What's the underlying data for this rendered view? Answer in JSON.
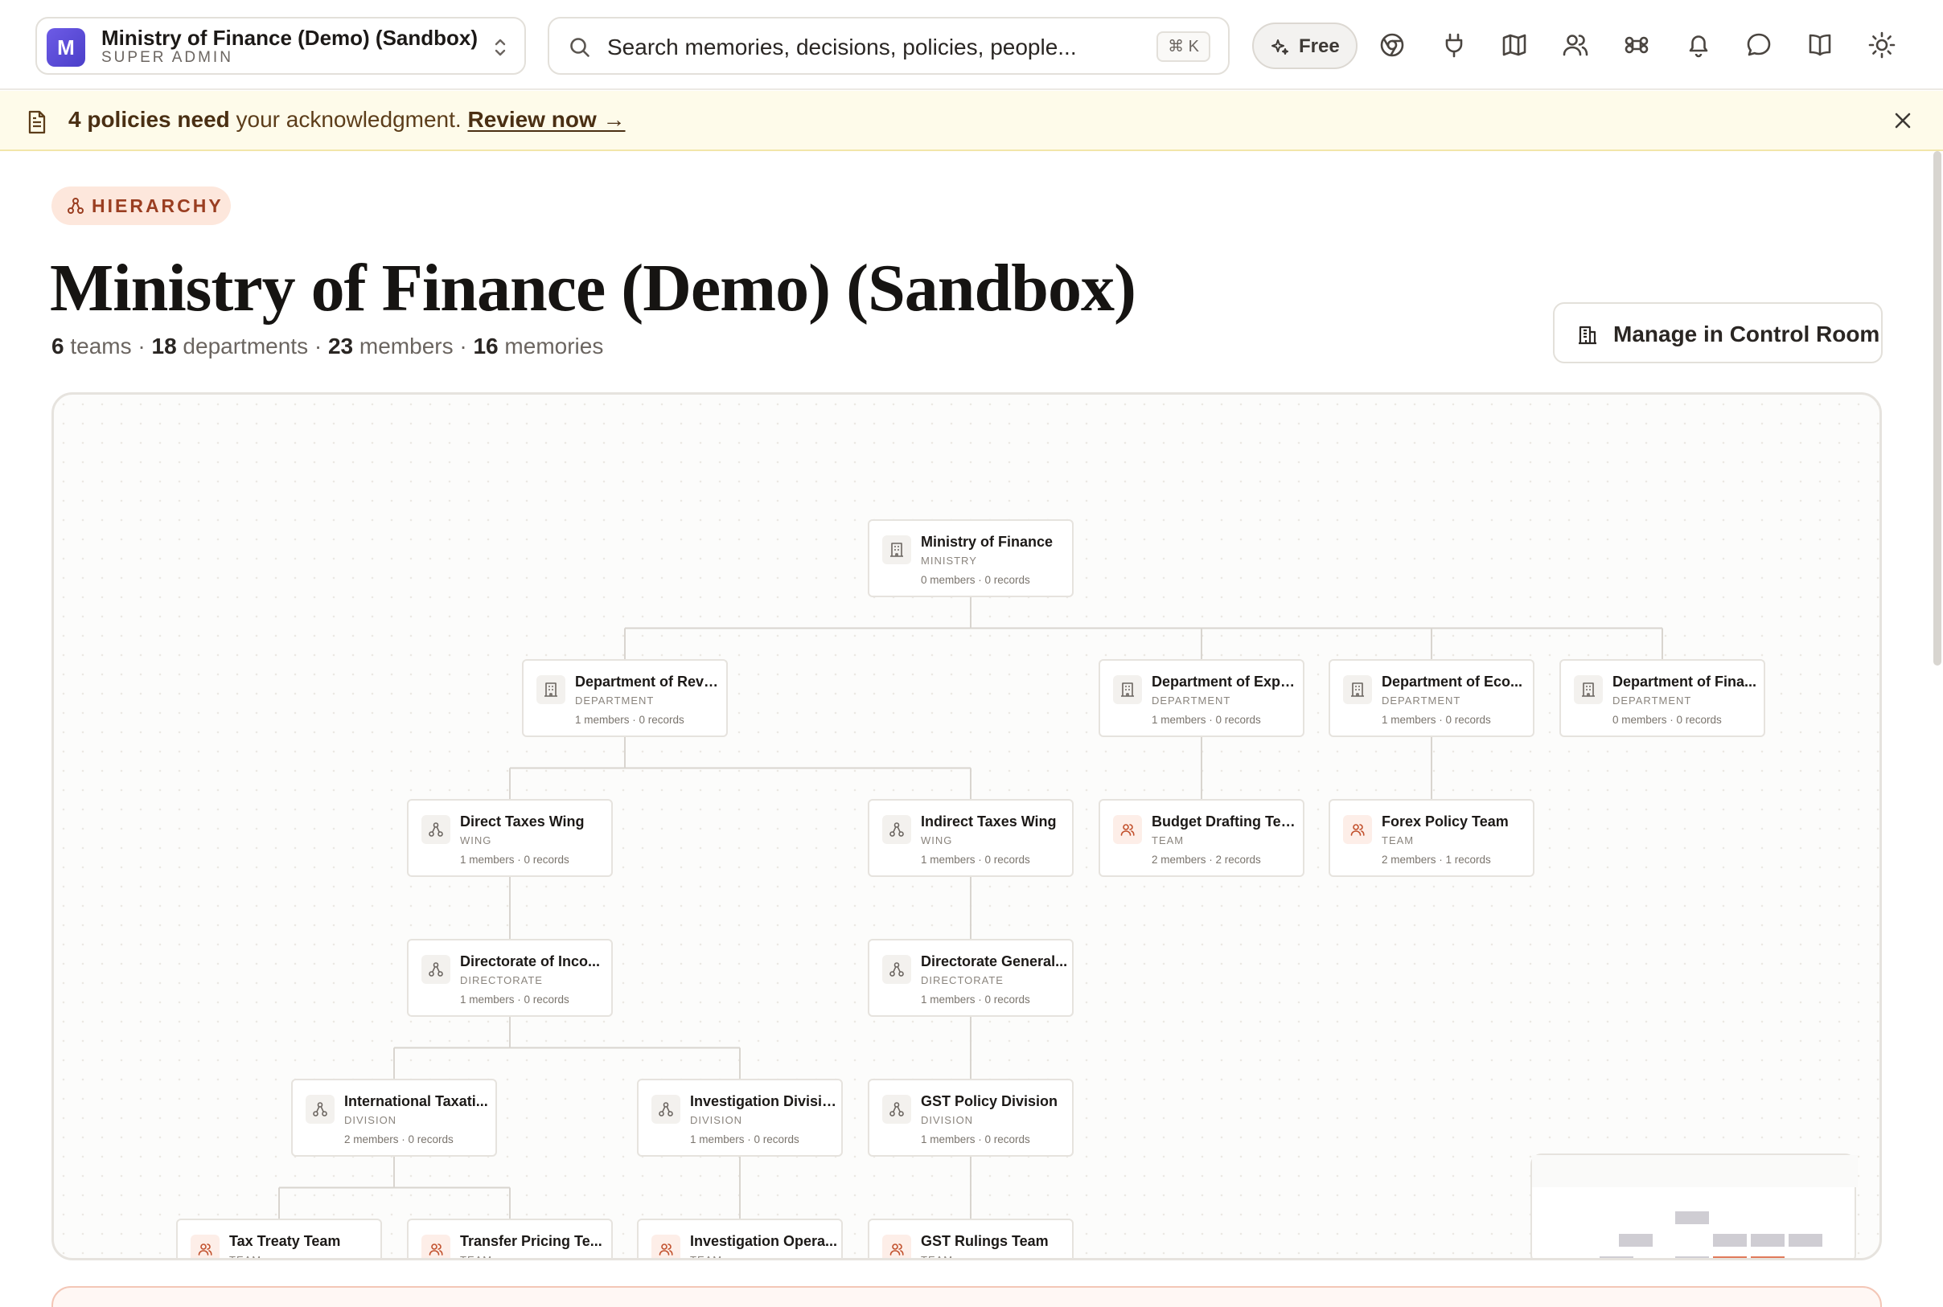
{
  "topbar": {
    "org": {
      "avatar_letter": "M",
      "name": "Ministry of Finance (Demo) (Sandbox)",
      "role": "SUPER ADMIN"
    },
    "search": {
      "placeholder": "Search memories, decisions, policies, people...",
      "shortcut": "⌘ K"
    },
    "plan": "Free",
    "icons": [
      "chrome-icon",
      "plug-icon",
      "map-icon",
      "users-icon",
      "command-icon",
      "bell-icon",
      "chat-icon",
      "book-icon",
      "sun-icon"
    ]
  },
  "banner": {
    "count_text": "4 policies need",
    "rest_text": " your acknowledgment. ",
    "link": "Review now →"
  },
  "header": {
    "pill": "HIERARCHY",
    "title": "Ministry of Finance (Demo) (Sandbox)",
    "stats": {
      "teams_n": "6",
      "teams_l": " teams · ",
      "depts_n": "18",
      "depts_l": " departments · ",
      "members_n": "23",
      "members_l": " members · ",
      "memories_n": "16",
      "memories_l": " memories"
    },
    "manage_button": "Manage in Control Room"
  },
  "colors": {
    "accent": "#c2512d",
    "banner_bg": "#fefbea",
    "pill_bg": "#fde7dc"
  },
  "hierarchy": {
    "nodes": [
      {
        "name": "Ministry of Finance",
        "type": "MINISTRY",
        "meta": "0 members · 0 records",
        "icon": "building-icon"
      },
      {
        "name": "Department of Reve...",
        "type": "DEPARTMENT",
        "meta": "1 members · 0 records",
        "icon": "building-icon"
      },
      {
        "name": "Department of Expe...",
        "type": "DEPARTMENT",
        "meta": "1 members · 0 records",
        "icon": "building-icon"
      },
      {
        "name": "Department of Eco...",
        "type": "DEPARTMENT",
        "meta": "1 members · 0 records",
        "icon": "building-icon"
      },
      {
        "name": "Department of Fina...",
        "type": "DEPARTMENT",
        "meta": "0 members · 0 records",
        "icon": "building-icon"
      },
      {
        "name": "Direct Taxes Wing",
        "type": "WING",
        "meta": "1 members · 0 records",
        "icon": "hierarchy-icon"
      },
      {
        "name": "Indirect Taxes Wing",
        "type": "WING",
        "meta": "1 members · 0 records",
        "icon": "hierarchy-icon"
      },
      {
        "name": "Budget Drafting Team",
        "type": "TEAM",
        "meta": "2 members · 2 records",
        "icon": "team-icon"
      },
      {
        "name": "Forex Policy Team",
        "type": "TEAM",
        "meta": "2 members · 1 records",
        "icon": "team-icon"
      },
      {
        "name": "Directorate of Inco...",
        "type": "DIRECTORATE",
        "meta": "1 members · 0 records",
        "icon": "hierarchy-icon"
      },
      {
        "name": "Directorate General...",
        "type": "DIRECTORATE",
        "meta": "1 members · 0 records",
        "icon": "hierarchy-icon"
      },
      {
        "name": "International Taxati...",
        "type": "DIVISION",
        "meta": "2 members · 0 records",
        "icon": "hierarchy-icon"
      },
      {
        "name": "Investigation Division",
        "type": "DIVISION",
        "meta": "1 members · 0 records",
        "icon": "hierarchy-icon"
      },
      {
        "name": "GST Policy Division",
        "type": "DIVISION",
        "meta": "1 members · 0 records",
        "icon": "hierarchy-icon"
      },
      {
        "name": "Tax Treaty Team",
        "type": "TEAM",
        "meta": "",
        "icon": "team-icon"
      },
      {
        "name": "Transfer Pricing Te...",
        "type": "TEAM",
        "meta": "",
        "icon": "team-icon"
      },
      {
        "name": "Investigation Opera...",
        "type": "TEAM",
        "meta": "",
        "icon": "team-icon"
      },
      {
        "name": "GST Rulings Team",
        "type": "TEAM",
        "meta": "",
        "icon": "team-icon"
      }
    ]
  }
}
